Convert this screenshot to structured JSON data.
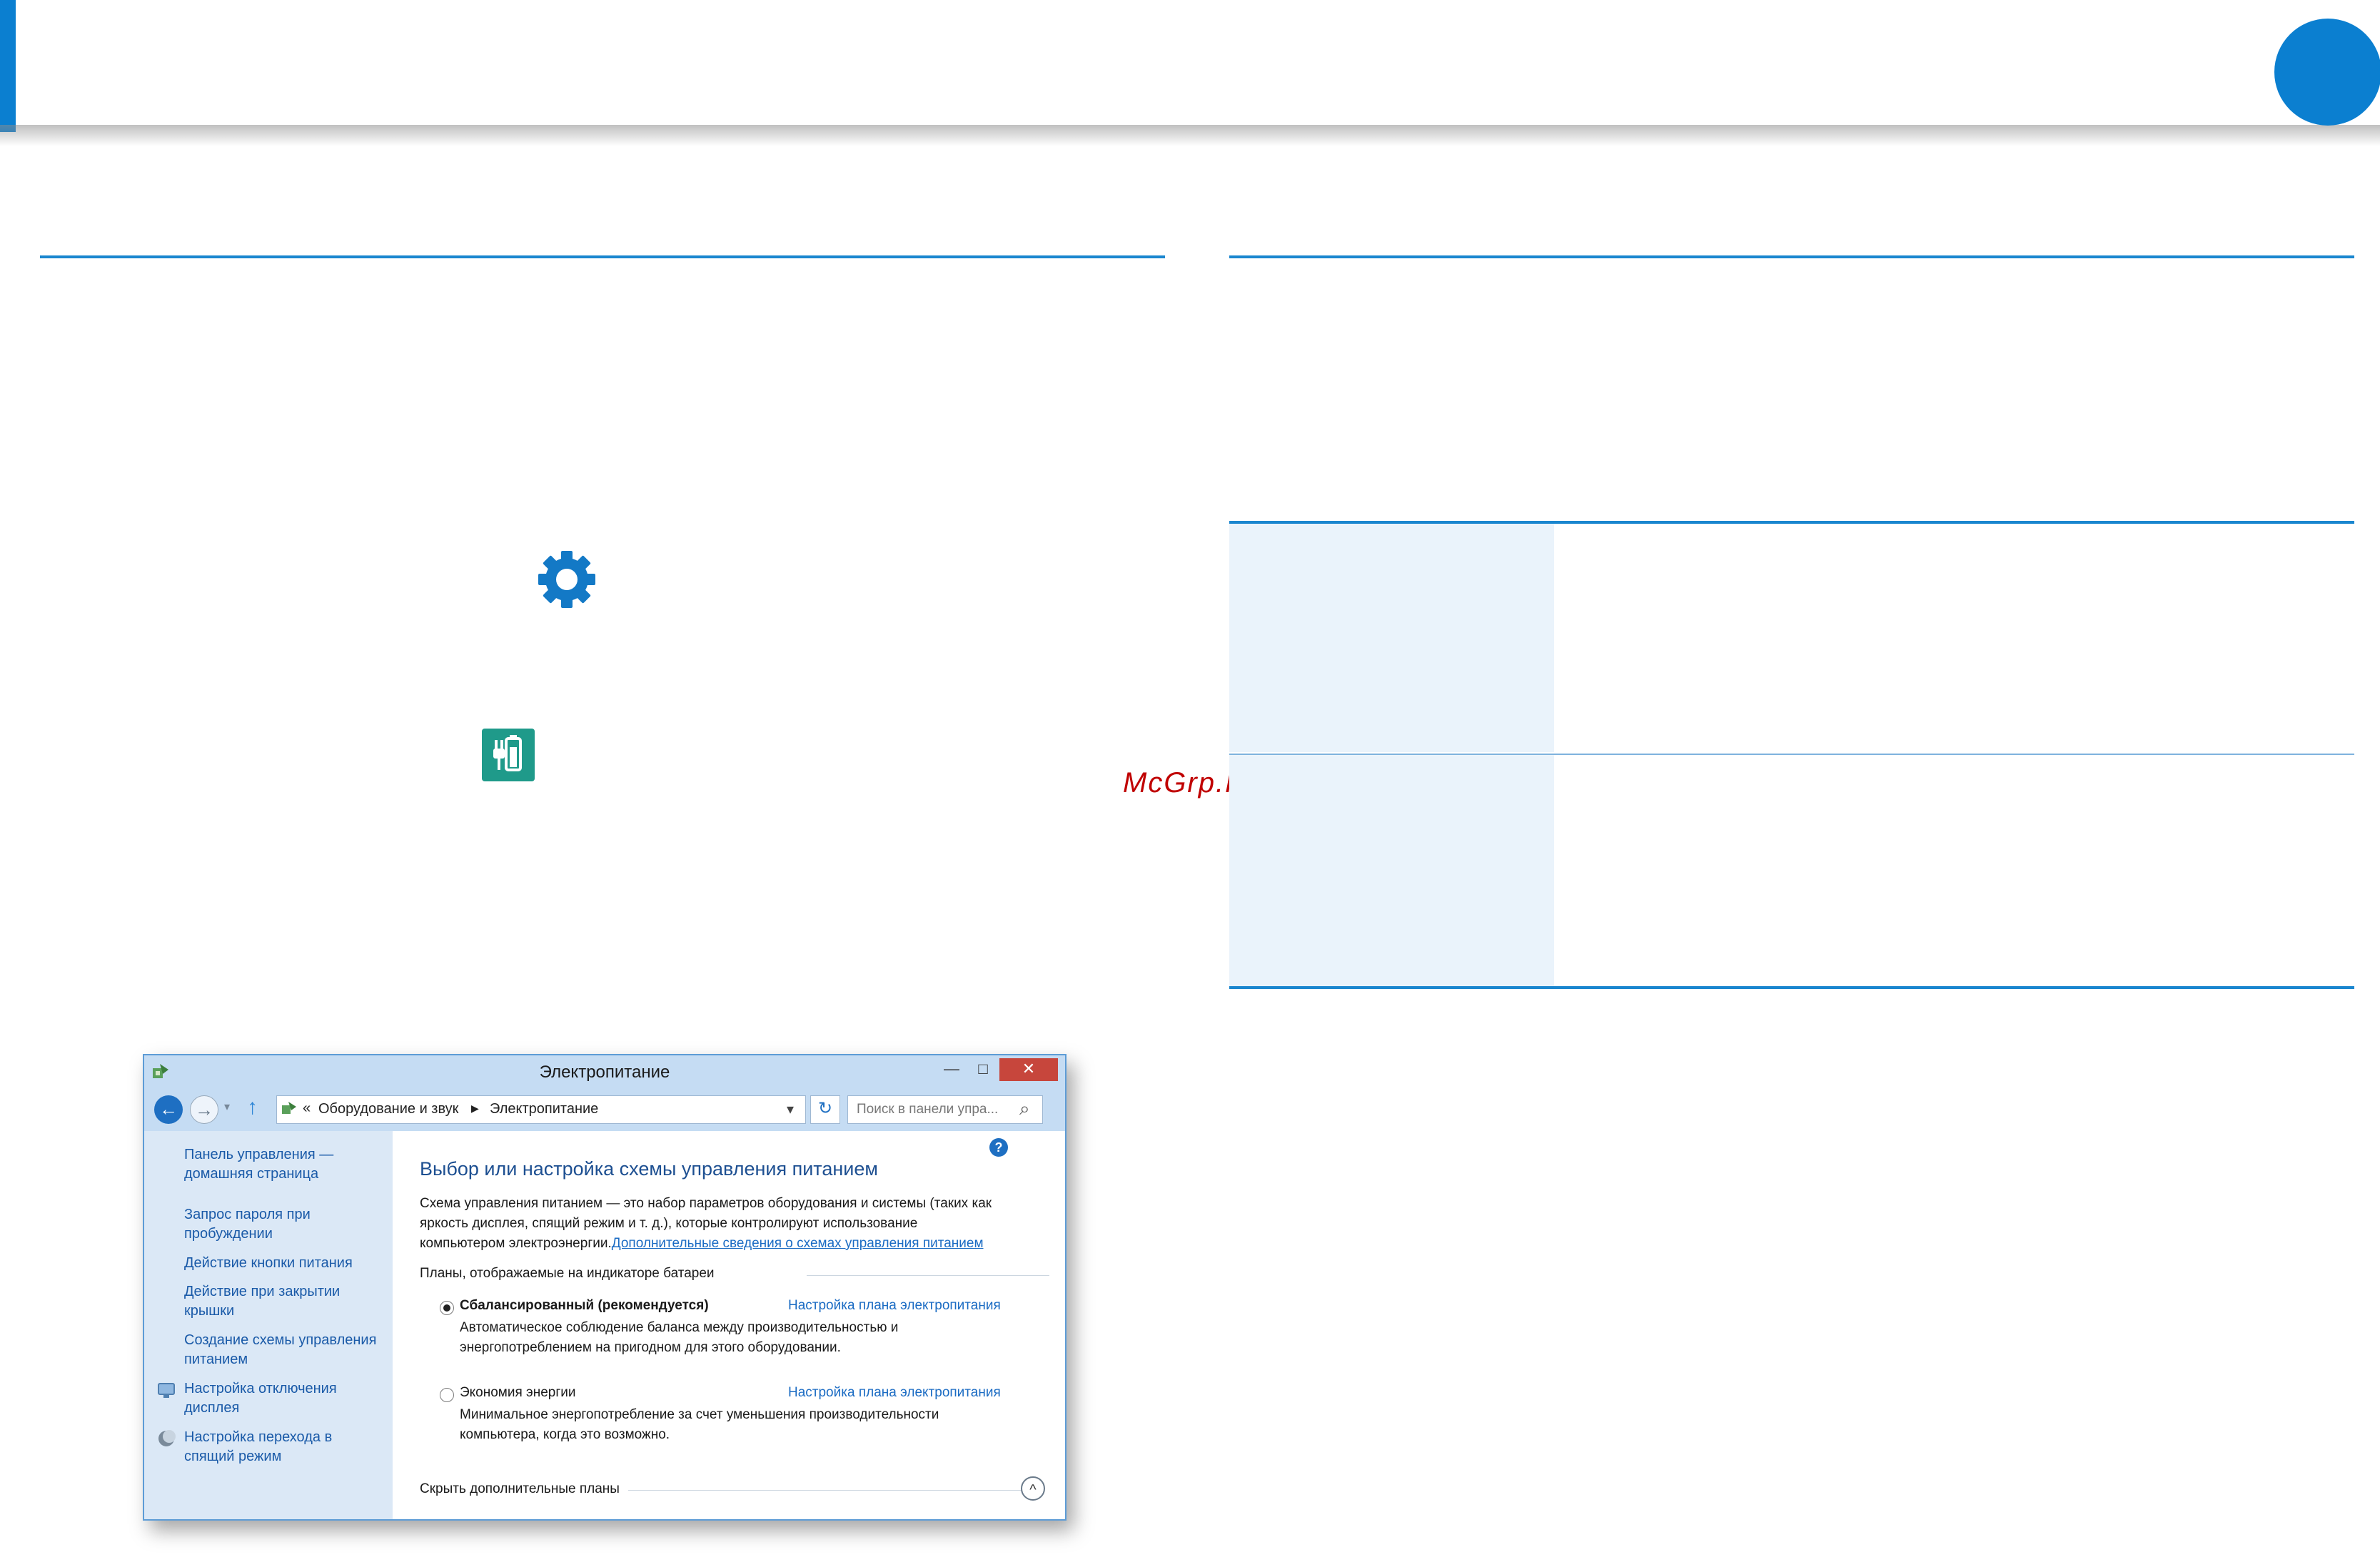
{
  "window": {
    "title": "Электропитание",
    "controls": {
      "minimize": "—",
      "maximize": "□",
      "close": "✕"
    },
    "toolbar": {
      "back_icon": "←",
      "forward_icon": "→",
      "recent_icon": "▾",
      "up_icon": "↑",
      "breadcrumb_prefix": "«",
      "breadcrumb_parent": "Оборудование и звук",
      "breadcrumb_sep": "▶",
      "breadcrumb_current": "Электропитание",
      "dropdown_icon": "▾",
      "refresh_icon": "↻",
      "search_placeholder": "Поиск в панели упра...",
      "search_icon": "⌕",
      "help_icon": "?"
    },
    "sidebar": {
      "home_link": [
        "Панель управления —",
        "домашняя страница"
      ],
      "links": [
        [
          "Запрос пароля при",
          "пробуждении"
        ],
        [
          "Действие кнопки питания"
        ],
        [
          "Действие при закрытии",
          "крышки"
        ],
        [
          "Создание схемы управления",
          "питанием"
        ],
        [
          "Настройка отключения",
          "дисплея"
        ],
        [
          "Настройка перехода в",
          "спящий режим"
        ]
      ]
    },
    "content": {
      "heading": "Выбор или настройка схемы управления питанием",
      "desc_lines": [
        "Схема управления питанием — это набор параметров оборудования и системы (таких как",
        "яркость дисплея, спящий режим и т. д.), которые контролируют использование",
        "компьютером электроэнергии."
      ],
      "desc_link": "Дополнительные сведения о схемах управления питанием",
      "plans_label": "Планы, отображаемые на индикаторе батареи",
      "plans": [
        {
          "name": "Сбалансированный (рекомендуется)",
          "selected": true,
          "settings_link": "Настройка плана электропитания",
          "desc": [
            "Автоматическое соблюдение баланса между производительностью и",
            "энергопотреблением на пригодном для этого оборудовании."
          ]
        },
        {
          "name": "Экономия энергии",
          "selected": false,
          "settings_link": "Настройка плана электропитания",
          "desc": [
            "Минимальное энергопотребление за счет уменьшения производительности",
            "компьютера, когда это возможно."
          ]
        }
      ],
      "hide_plans": "Скрыть дополнительные планы",
      "collapse_icon": "^"
    }
  },
  "watermark": "McGrp.Ru",
  "colors": {
    "accent": "#0b7fd0",
    "rule": "#1a86cf",
    "table_shade": "#eaf3fb",
    "link": "#1a5aa8"
  }
}
